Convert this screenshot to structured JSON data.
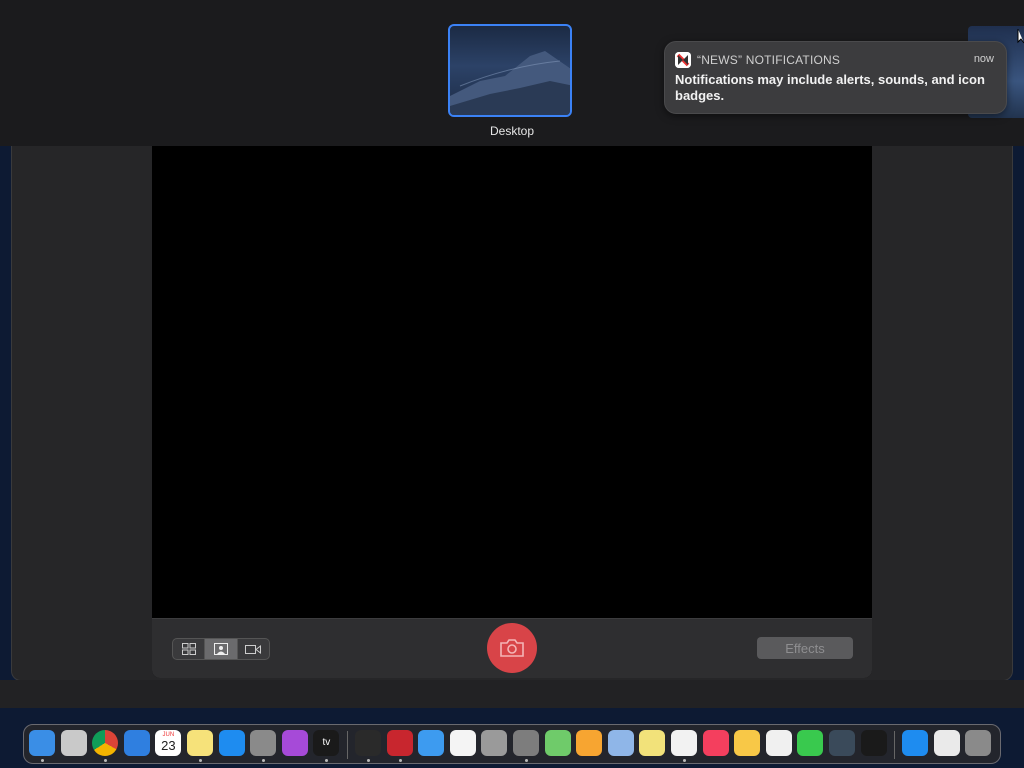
{
  "spaces": {
    "desktop_label": "Desktop"
  },
  "notification": {
    "app_name": "“NEWS” NOTIFICATIONS",
    "time": "now",
    "body": "Notifications may include alerts, sounds, and icon badges.",
    "icon": "news-icon"
  },
  "photo_booth": {
    "view_modes": [
      {
        "name": "grid-view",
        "icon": "grid-icon",
        "active": false
      },
      {
        "name": "single-photo",
        "icon": "portrait-icon",
        "active": true
      },
      {
        "name": "video",
        "icon": "video-camera-icon",
        "active": false
      }
    ],
    "shutter_icon": "camera-icon",
    "effects_label": "Effects"
  },
  "dock": {
    "calendar_month": "JUN",
    "calendar_day": "23",
    "tv_label": "tv",
    "apps": [
      {
        "name": "finder",
        "color": "#3a8ee6",
        "running": true
      },
      {
        "name": "launchpad",
        "color": "#c9c9c9",
        "running": false
      },
      {
        "name": "chrome",
        "color": "#e8e8e8",
        "running": true
      },
      {
        "name": "safari",
        "color": "#2f7fe0",
        "running": false
      },
      {
        "name": "calendar",
        "color": "#ffffff",
        "running": false
      },
      {
        "name": "notes",
        "color": "#f6e27a",
        "running": true
      },
      {
        "name": "app-store",
        "color": "#1e8cf0",
        "running": false
      },
      {
        "name": "system-preferences",
        "color": "#8a8a8a",
        "running": true
      },
      {
        "name": "podcasts",
        "color": "#a64ad8",
        "running": false
      },
      {
        "name": "apple-tv",
        "color": "#1a1a1a",
        "running": true
      },
      {
        "name": "activity-monitor",
        "color": "#2a2a2a",
        "running": true
      },
      {
        "name": "photo-booth",
        "color": "#c8262e",
        "running": true
      },
      {
        "name": "mail",
        "color": "#3d9bf0",
        "running": false
      },
      {
        "name": "reminders",
        "color": "#f4f4f4",
        "running": false
      },
      {
        "name": "font-book",
        "color": "#9a9a9a",
        "running": false
      },
      {
        "name": "screenshot",
        "color": "#7d7d7d",
        "running": true
      },
      {
        "name": "maps",
        "color": "#6fcb6a",
        "running": false
      },
      {
        "name": "home",
        "color": "#f7a531",
        "running": false
      },
      {
        "name": "preview",
        "color": "#8fb6e8",
        "running": false
      },
      {
        "name": "stickies",
        "color": "#f2e27a",
        "running": false
      },
      {
        "name": "news",
        "color": "#f2f2f2",
        "running": true
      },
      {
        "name": "music",
        "color": "#f43f5e",
        "running": false
      },
      {
        "name": "photos",
        "color": "#f8c847",
        "running": false
      },
      {
        "name": "textedit",
        "color": "#f0f0f0",
        "running": false
      },
      {
        "name": "messages",
        "color": "#39c94e",
        "running": false
      },
      {
        "name": "quicktime",
        "color": "#3a4a5a",
        "running": false
      },
      {
        "name": "voice-memos",
        "color": "#1a1a1a",
        "running": false
      },
      {
        "name": "app-store-folder",
        "color": "#1e8cf0",
        "running": false
      },
      {
        "name": "documents",
        "color": "#eaeaea",
        "running": false
      },
      {
        "name": "trash",
        "color": "#8a8a8a",
        "running": false
      }
    ]
  }
}
